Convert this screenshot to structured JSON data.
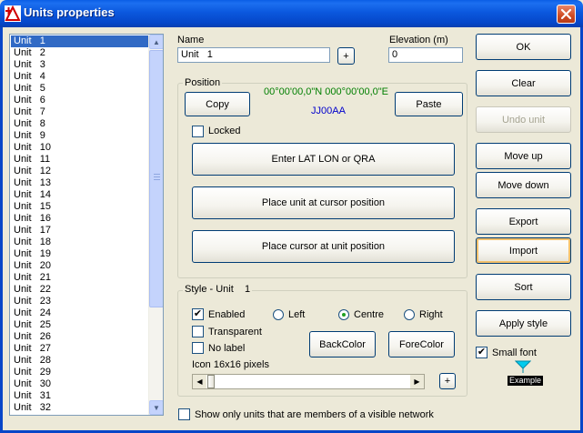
{
  "window": {
    "title": "Units properties"
  },
  "units_list": {
    "selected_index": 0,
    "items": [
      "Unit   1",
      "Unit   2",
      "Unit   3",
      "Unit   4",
      "Unit   5",
      "Unit   6",
      "Unit   7",
      "Unit   8",
      "Unit   9",
      "Unit   10",
      "Unit   11",
      "Unit   12",
      "Unit   13",
      "Unit   14",
      "Unit   15",
      "Unit   16",
      "Unit   17",
      "Unit   18",
      "Unit   19",
      "Unit   20",
      "Unit   21",
      "Unit   22",
      "Unit   23",
      "Unit   24",
      "Unit   25",
      "Unit   26",
      "Unit   27",
      "Unit   28",
      "Unit   29",
      "Unit   30",
      "Unit   31",
      "Unit   32"
    ]
  },
  "name": {
    "label": "Name",
    "value": "Unit   1",
    "plus_label": "+"
  },
  "elevation": {
    "label": "Elevation (m)",
    "value": "0"
  },
  "position": {
    "title": "Position",
    "copy_label": "Copy",
    "paste_label": "Paste",
    "coordinates": "00°00'00,0\"N 000°00'00,0\"E",
    "qra": "JJ00AA",
    "locked_label": "Locked",
    "locked_checked": false,
    "enter_label": "Enter LAT LON or QRA",
    "place_unit_label": "Place unit at cursor position",
    "place_cursor_label": "Place cursor at unit position"
  },
  "style": {
    "title": "Style - Unit    1",
    "enabled_label": "Enabled",
    "enabled_checked": true,
    "transparent_label": "Transparent",
    "transparent_checked": false,
    "nolabel_label": "No label",
    "nolabel_checked": false,
    "align_left_label": "Left",
    "align_centre_label": "Centre",
    "align_right_label": "Right",
    "align_selected": "Centre",
    "backcolor_label": "BackColor",
    "forecolor_label": "ForeColor",
    "icon_label": "Icon 16x16 pixels",
    "icon_plus_label": "+"
  },
  "show_only_label": "Show only units that are members of a visible network",
  "show_only_checked": false,
  "side_buttons": {
    "ok": "OK",
    "clear": "Clear",
    "undo": "Undo unit",
    "move_up": "Move up",
    "move_down": "Move down",
    "export": "Export",
    "import": "Import",
    "sort": "Sort",
    "apply_style": "Apply style"
  },
  "small_font": {
    "label": "Small font",
    "checked": true
  },
  "example_label": "Example",
  "colors": {
    "title_bar": "#0a5ee6",
    "selection": "#316ac5",
    "coord_green": "#007f00",
    "qra_blue": "#0000cc",
    "example_marker": "#00ccee"
  }
}
